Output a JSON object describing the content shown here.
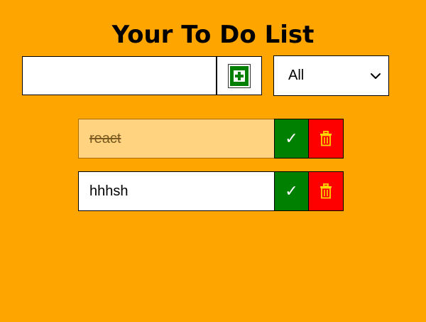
{
  "header": {
    "title": "Your To Do List"
  },
  "form": {
    "input_value": "",
    "input_placeholder": "",
    "add_icon": "plus-square-icon",
    "filter": {
      "selected": "All",
      "options": [
        "All"
      ]
    }
  },
  "todos": [
    {
      "text": "react",
      "completed": true
    },
    {
      "text": "hhhsh",
      "completed": false
    }
  ],
  "icons": {
    "complete": "checkmark-icon",
    "delete": "trash-icon"
  },
  "colors": {
    "background": "#FFA500",
    "complete_button": "#008000",
    "delete_button": "#FF0000",
    "completed_item": "#FFD37F",
    "trash_icon": "#FFD700"
  }
}
